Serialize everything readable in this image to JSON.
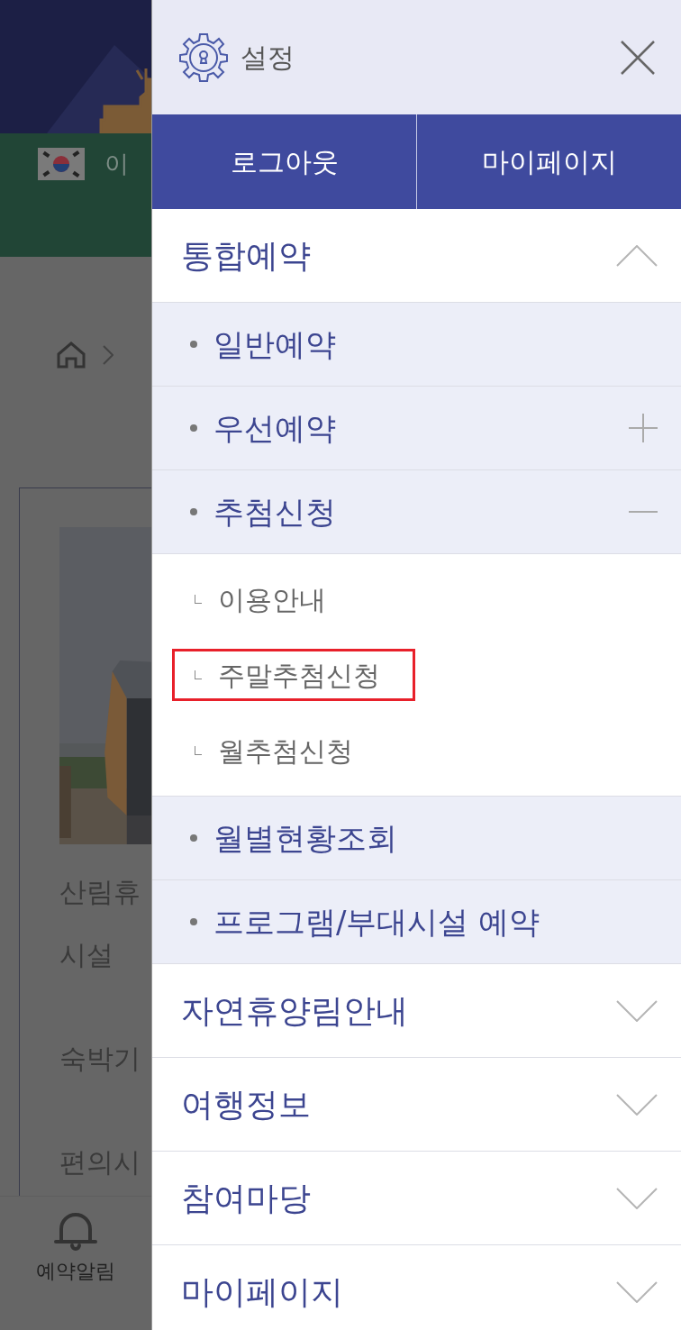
{
  "background": {
    "banner_text": "이",
    "card_labels": [
      "산림휴",
      "시설",
      "숙박기",
      "편의시"
    ],
    "bottom_nav": [
      {
        "label": "예약알림"
      }
    ]
  },
  "drawer": {
    "title": "설정",
    "buttons": [
      "로그아웃",
      "마이페이지"
    ],
    "sections": [
      {
        "label": "통합예약",
        "expanded": true,
        "children": [
          {
            "label": "일반예약",
            "kind": "link"
          },
          {
            "label": "우선예약",
            "kind": "group",
            "expanded": false
          },
          {
            "label": "추첨신청",
            "kind": "group",
            "expanded": true,
            "children": [
              {
                "label": "이용안내",
                "highlighted": false
              },
              {
                "label": "주말추첨신청",
                "highlighted": true
              },
              {
                "label": "월추첨신청",
                "highlighted": false
              }
            ]
          },
          {
            "label": "월별현황조회",
            "kind": "link"
          },
          {
            "label": "프로그램/부대시설 예약",
            "kind": "link"
          }
        ]
      },
      {
        "label": "자연휴양림안내",
        "expanded": false
      },
      {
        "label": "여행정보",
        "expanded": false
      },
      {
        "label": "참여마당",
        "expanded": false
      },
      {
        "label": "마이페이지",
        "expanded": false
      }
    ]
  }
}
